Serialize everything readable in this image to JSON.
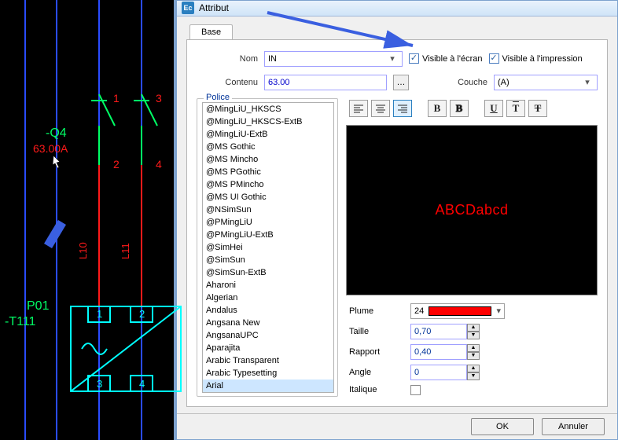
{
  "window": {
    "title": "Attribut",
    "icon_label": "Ec"
  },
  "tab": {
    "base": "Base"
  },
  "form": {
    "name_label": "Nom",
    "name_value": "IN",
    "content_label": "Contenu",
    "content_value": "63.00",
    "visible_screen": "Visible à l'écran",
    "visible_print": "Visible à l'impression",
    "layer_label": "Couche",
    "layer_value": "(A)"
  },
  "fontbox": {
    "legend": "Police"
  },
  "fonts": [
    "@MingLiU_HKSCS",
    "@MingLiU_HKSCS-ExtB",
    "@MingLiU-ExtB",
    "@MS Gothic",
    "@MS Mincho",
    "@MS PGothic",
    "@MS PMincho",
    "@MS UI Gothic",
    "@NSimSun",
    "@PMingLiU",
    "@PMingLiU-ExtB",
    "@SimHei",
    "@SimSun",
    "@SimSun-ExtB",
    "Aharoni",
    "Algerian",
    "Andalus",
    "Angsana New",
    "AngsanaUPC",
    "Aparajita",
    "Arabic Transparent",
    "Arabic Typesetting",
    "Arial"
  ],
  "font_selected_index": 22,
  "preview_text": "ABCDabcd",
  "props": {
    "pen_label": "Plume",
    "pen_number": "24",
    "pen_color": "#ff0000",
    "size_label": "Taille",
    "size_value": "0,70",
    "ratio_label": "Rapport",
    "ratio_value": "0,40",
    "angle_label": "Angle",
    "angle_value": "0",
    "italic_label": "Italique"
  },
  "footer": {
    "ok": "OK",
    "cancel": "Annuler"
  },
  "canvas_labels": {
    "q4": "-Q4",
    "q4_val": "63.00A",
    "p01": "P01",
    "t111": "-T111",
    "L10": "L10",
    "L11": "L11",
    "n1": "1",
    "n2": "2",
    "n3": "3",
    "n4": "4"
  }
}
